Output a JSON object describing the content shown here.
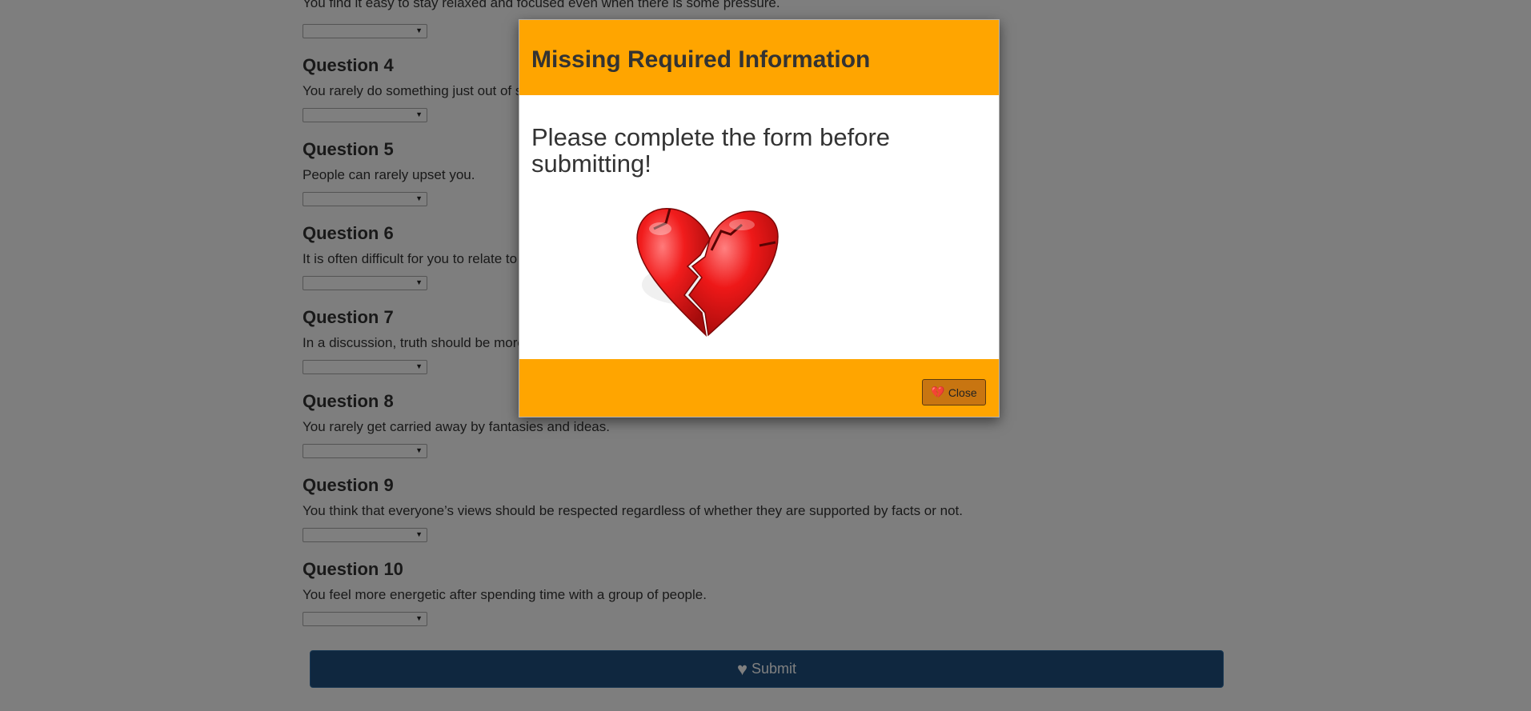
{
  "form": {
    "q3_text": "You find it easy to stay relaxed and focused even when there is some pressure.",
    "questions": [
      {
        "title": "Question 4",
        "text": "You rarely do something just out of sheer curiosity."
      },
      {
        "title": "Question 5",
        "text": "People can rarely upset you."
      },
      {
        "title": "Question 6",
        "text": "It is often difficult for you to relate to other people's feelings."
      },
      {
        "title": "Question 7",
        "text": "In a discussion, truth should be more important than people's sensitivities."
      },
      {
        "title": "Question 8",
        "text": "You rarely get carried away by fantasies and ideas."
      },
      {
        "title": "Question 9",
        "text": "You think that everyone’s views should be respected regardless of whether they are supported by facts or not."
      },
      {
        "title": "Question 10",
        "text": "You feel more energetic after spending time with a group of people."
      }
    ],
    "select_value": "",
    "submit_label": "Submit"
  },
  "icons": {
    "submit": "heart-icon",
    "close": "broken-heart-icon",
    "select_caret": "caret-down-icon",
    "illustration": "broken-heart-illustration"
  },
  "modal": {
    "title": "Missing Required Information",
    "message": "Please complete the form before submitting!",
    "close_label": "Close"
  },
  "colors": {
    "modal_header": "#ffa500",
    "modal_footer": "#ffa500",
    "close_button": "#c87511",
    "submit_button": "#1e4f7f",
    "heart": "#e5171a",
    "backdrop": "rgba(0,0,0,0.5)"
  }
}
